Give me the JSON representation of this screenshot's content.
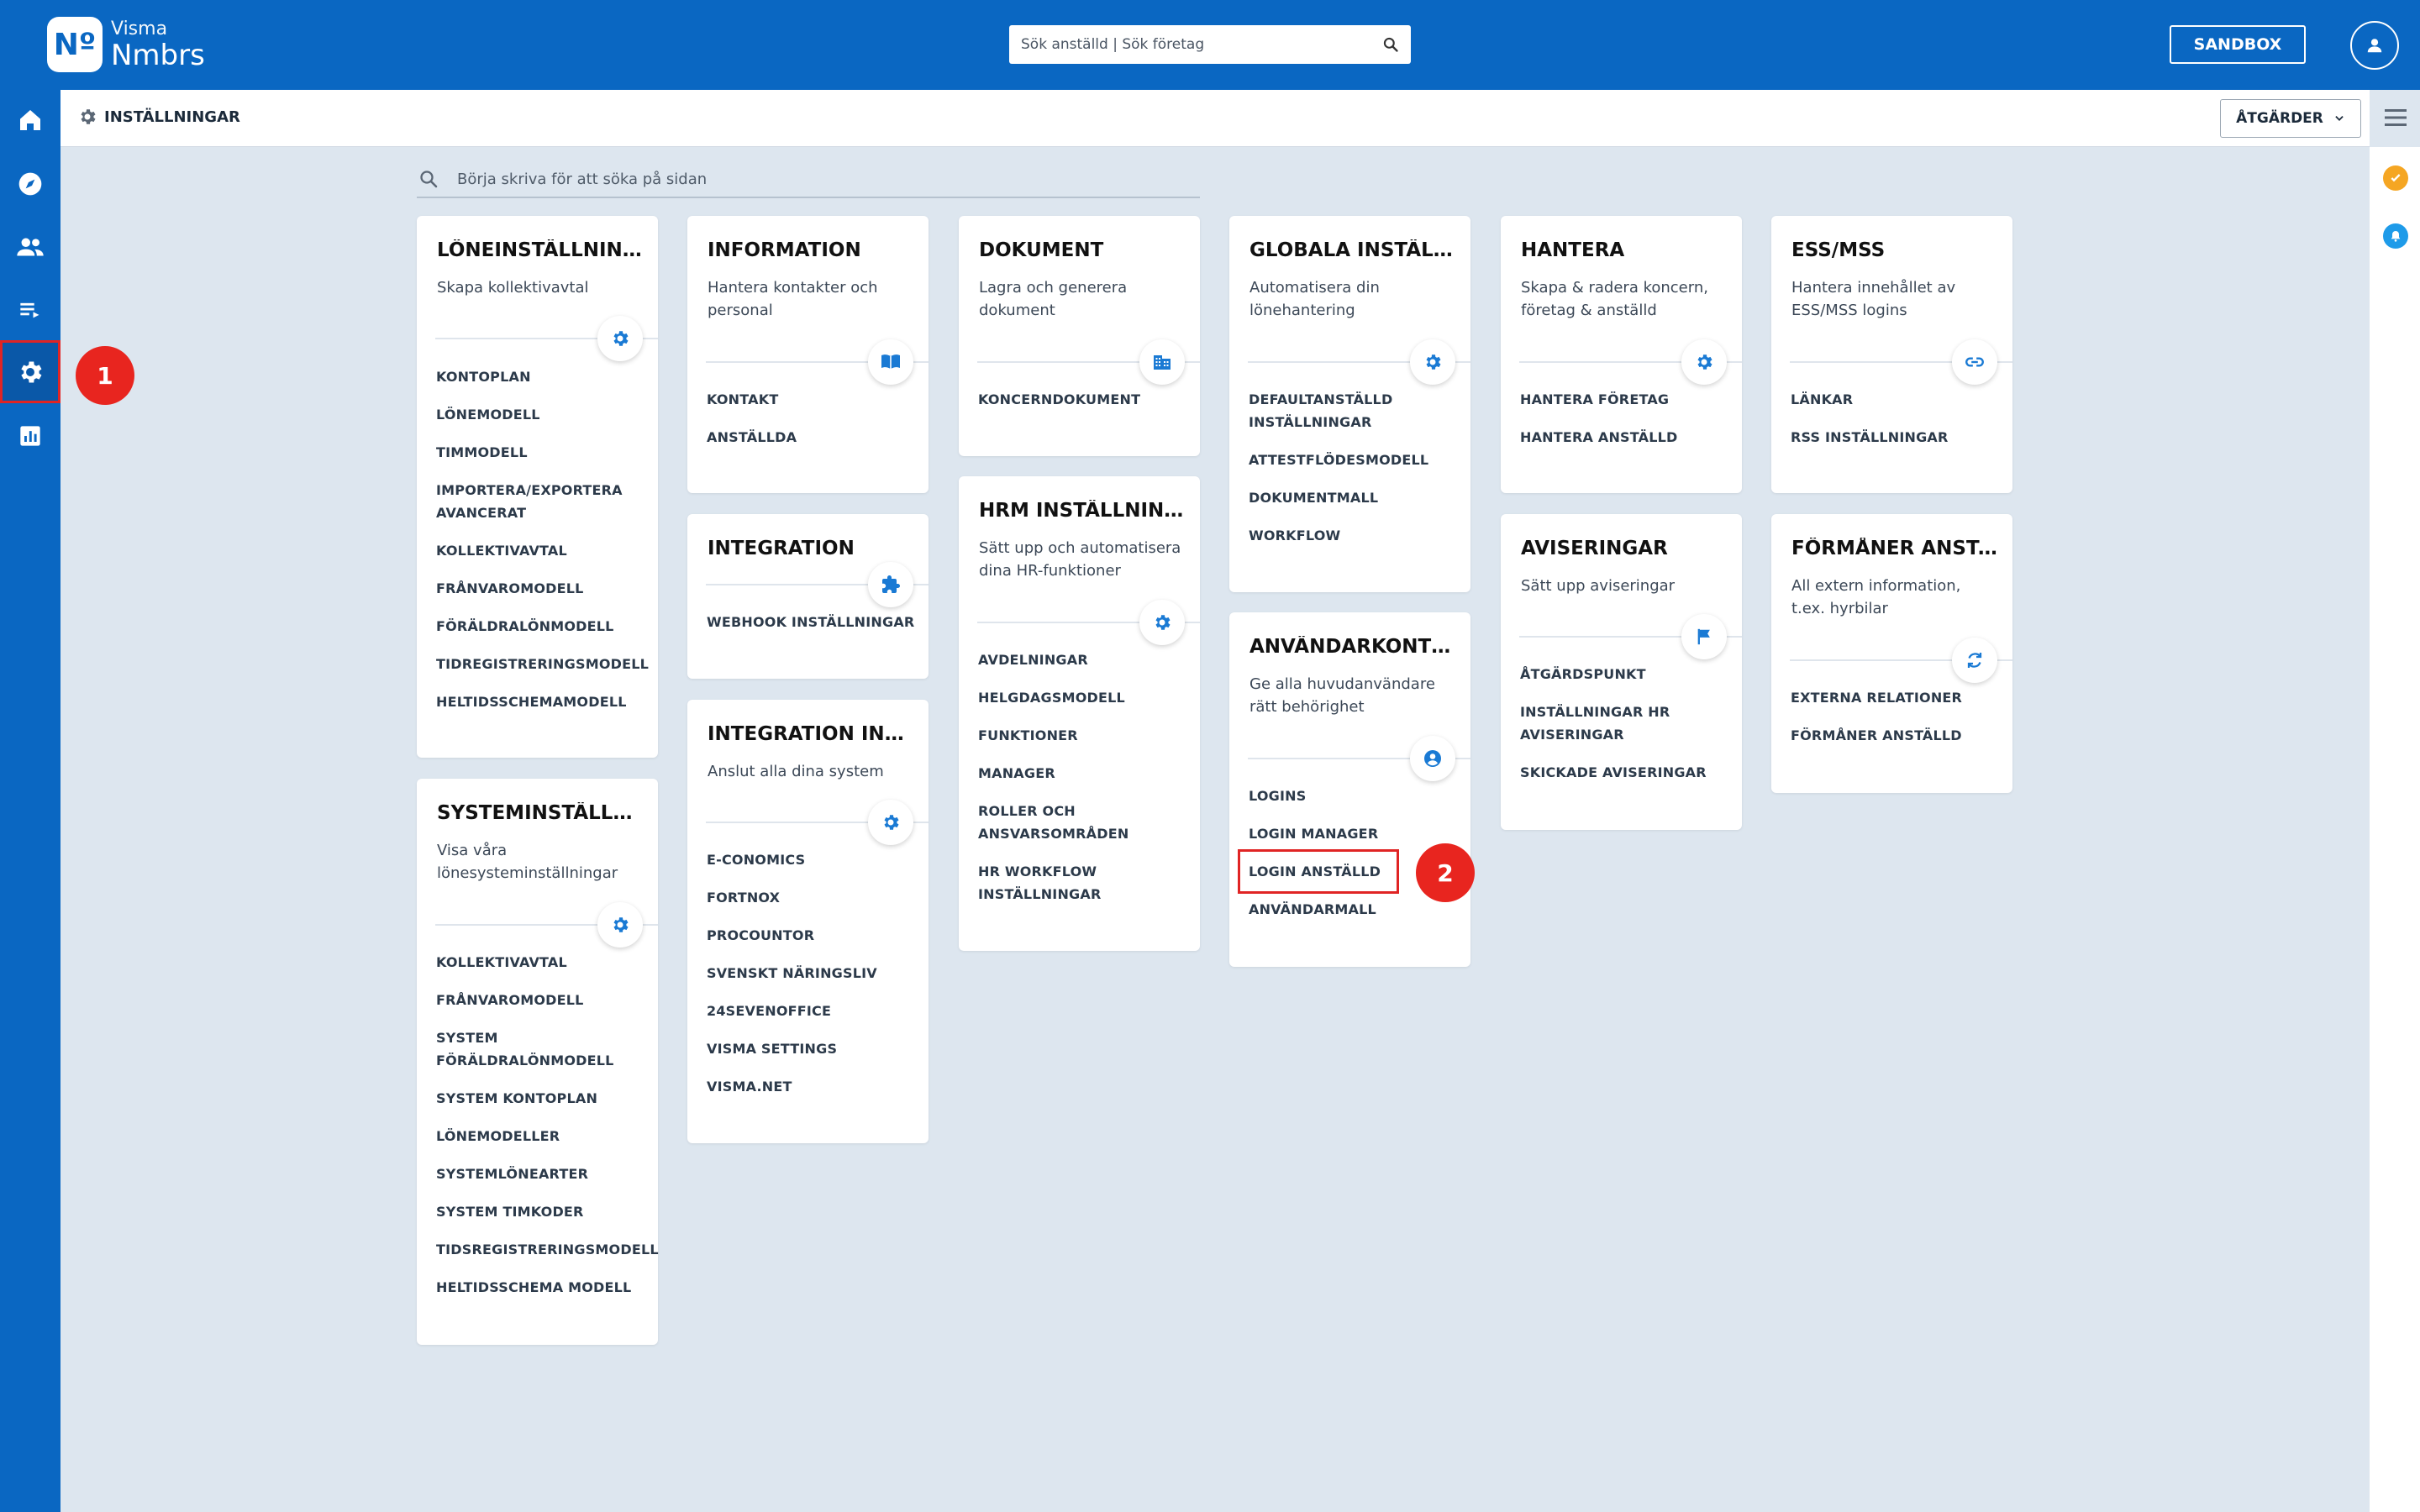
{
  "brand": {
    "logo": "Nº",
    "line1": "Visma",
    "line2": "Nmbrs"
  },
  "topbar": {
    "search_placeholder": "Sök anställd | Sök företag",
    "sandbox_label": "SANDBOX"
  },
  "sidebar": {
    "items": [
      "home-icon",
      "compass-icon",
      "people-icon",
      "list-icon",
      "settings-icon",
      "chart-icon"
    ],
    "active_index": 4
  },
  "annotations": {
    "badge1": "1",
    "badge2": "2"
  },
  "subheader": {
    "title": "INSTÄLLNINGAR",
    "actions_label": "ÅTGÄRDER"
  },
  "page_search": {
    "placeholder": "Börja skriva för att söka på sidan"
  },
  "colors": {
    "primary": "#0a67c2",
    "badge": "#e8251f",
    "highlight": "#e02424",
    "status_orange": "#f5a623",
    "status_blue": "#1e9be9"
  },
  "cards": {
    "loneinstallningar": {
      "title": "LÖNEINSTÄLLNINGAR",
      "desc": "Skapa kollektivavtal",
      "icon": "gear-icon",
      "links": [
        "KONTOPLAN",
        "LÖNEMODELL",
        "TIMMODELL",
        "IMPORTERA/EXPORTERA AVANCERAT",
        "KOLLEKTIVAVTAL",
        "FRÅNVAROMODELL",
        "FÖRÄLDRALÖNMODELL",
        "TIDREGISTRERINGSMODELL",
        "HELTIDSSCHEMAMODELL"
      ]
    },
    "systeminstallningar": {
      "title": "SYSTEMINSTÄLLNINGAR",
      "desc": "Visa våra lönesysteminställningar",
      "icon": "gear-icon",
      "links": [
        "KOLLEKTIVAVTAL",
        "FRÅNVAROMODELL",
        "SYSTEM FÖRÄLDRALÖNMODELL",
        "SYSTEM KONTOPLAN",
        "LÖNEMODELLER",
        "SYSTEMLÖNEARTER",
        "SYSTEM TIMKODER",
        "TIDSREGISTRERINGSMODELL",
        "HELTIDSSCHEMA MODELL"
      ]
    },
    "information": {
      "title": "INFORMATION",
      "desc": "Hantera kontakter och personal",
      "icon": "book-icon",
      "links": [
        "KONTAKT",
        "ANSTÄLLDA"
      ]
    },
    "integration": {
      "title": "INTEGRATION",
      "desc": "",
      "icon": "puzzle-icon",
      "links": [
        "WEBHOOK INSTÄLLNINGAR"
      ]
    },
    "integration_inst": {
      "title": "INTEGRATION INSTÄLLNINGAR",
      "desc": "Anslut alla dina system",
      "icon": "gear-icon",
      "links": [
        "E-CONOMICS",
        "FORTNOX",
        "PROCOUNTOR",
        "SVENSKT NÄRINGSLIV",
        "24SEVENOFFICE",
        "VISMA SETTINGS",
        "VISMA.NET"
      ]
    },
    "dokument": {
      "title": "DOKUMENT",
      "desc": "Lagra och generera dokument",
      "icon": "building-icon",
      "links": [
        "KONCERNDOKUMENT"
      ]
    },
    "hrm": {
      "title": "HRM INSTÄLLNINGAR",
      "desc": "Sätt upp och automatisera dina HR-funktioner",
      "icon": "gear-icon",
      "links": [
        "AVDELNINGAR",
        "HELGDAGSMODELL",
        "FUNKTIONER",
        "MANAGER",
        "ROLLER OCH ANSVARSOMRÅDEN",
        "HR WORKFLOW INSTÄLLNINGAR"
      ]
    },
    "globala": {
      "title": "GLOBALA INSTÄLLNINGAR",
      "desc": "Automatisera din lönehantering",
      "icon": "gear-icon",
      "links": [
        "DEFAULTANSTÄLLD INSTÄLLNINGAR",
        "ATTESTFLÖDESMODELL",
        "DOKUMENTMALL",
        "WORKFLOW"
      ]
    },
    "anvandarkonton": {
      "title": "ANVÄNDARKONTON",
      "desc": "Ge alla huvudanvändare rätt behörighet",
      "icon": "user-circle-icon",
      "links": [
        "LOGINS",
        "LOGIN MANAGER",
        "LOGIN ANSTÄLLD",
        "ANVÄNDARMALL"
      ]
    },
    "hantera": {
      "title": "HANTERA",
      "desc": "Skapa & radera koncern, företag & anställd",
      "icon": "gear-icon",
      "links": [
        "HANTERA FÖRETAG",
        "HANTERA ANSTÄLLD"
      ]
    },
    "aviseringar": {
      "title": "AVISERINGAR",
      "desc": "Sätt upp aviseringar",
      "icon": "flag-icon",
      "links": [
        "ÅTGÄRDSPUNKT",
        "INSTÄLLNINGAR HR AVISERINGAR",
        "SKICKADE AVISERINGAR"
      ]
    },
    "essmss": {
      "title": "ESS/MSS",
      "desc": "Hantera innehållet av ESS/MSS logins",
      "icon": "link-icon",
      "links": [
        "LÄNKAR",
        "RSS INSTÄLLNINGAR"
      ]
    },
    "formaner": {
      "title": "FÖRMÅNER ANSTÄLLD",
      "desc": "All extern information, t.ex. hyrbilar",
      "icon": "refresh-icon",
      "links": [
        "EXTERNA RELATIONER",
        "FÖRMÅNER ANSTÄLLD"
      ]
    }
  }
}
